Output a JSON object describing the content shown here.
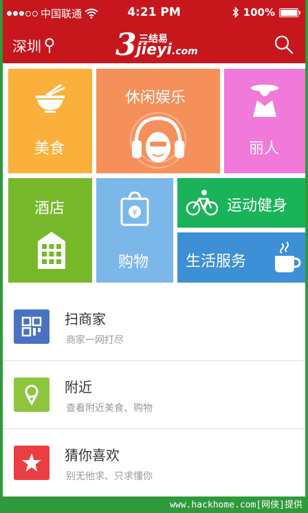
{
  "status_bar": {
    "carrier": "中国联通",
    "time": "4:21 PM",
    "battery": "100%"
  },
  "app_bar": {
    "city": "深圳",
    "logo_cn": "三结易",
    "logo_en": "jieyi",
    "logo_domain": ".com",
    "logo_three": "3"
  },
  "tiles": {
    "food": "美食",
    "leisure": "休闲娱乐",
    "beauty": "丽人",
    "hotel": "酒店",
    "shopping": "购物",
    "sport": "运动健身",
    "life": "生活服务"
  },
  "list": [
    {
      "title": "扫商家",
      "subtitle": "商家一网打尽",
      "icon": "qr-code-icon",
      "color": "#4a72c4"
    },
    {
      "title": "附近",
      "subtitle": "查看附近美食、购物",
      "icon": "location-pin-icon",
      "color": "#8cc63f"
    },
    {
      "title": "猜你喜欢",
      "subtitle": "别无他求、只求懂你",
      "icon": "star-icon",
      "color": "#ea3e42"
    }
  ],
  "watermark": "www.hackhome.com[网侠]提供",
  "colors": {
    "brand_red": "#c8161d",
    "food": "#fbb03b",
    "leisure": "#f6905a",
    "beauty": "#f079d9",
    "hotel": "#76b82a",
    "shopping": "#7cb7ea",
    "sport": "#19b35a",
    "life": "#3d8fd6"
  }
}
